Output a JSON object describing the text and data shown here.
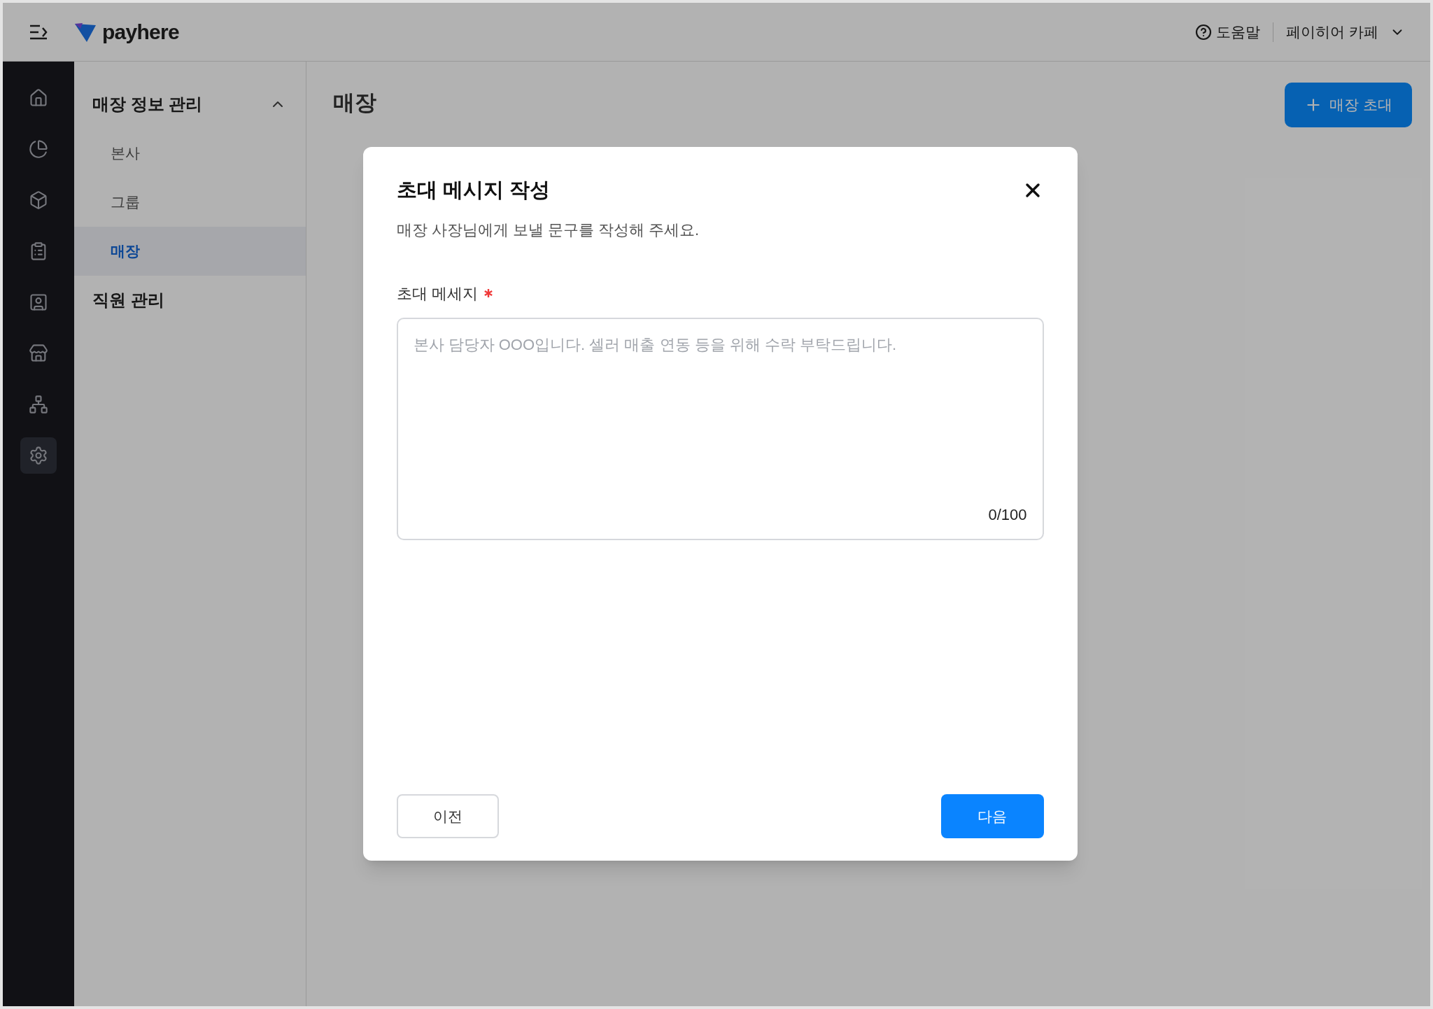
{
  "top_bar": {
    "logo_text": "payhere",
    "help": "도움말",
    "store": "페이히어 카페"
  },
  "rail": [
    {
      "kind": "home",
      "selected": false
    },
    {
      "kind": "chart",
      "selected": false
    },
    {
      "kind": "box",
      "selected": false
    },
    {
      "kind": "clipboard",
      "selected": false
    },
    {
      "kind": "contact",
      "selected": false
    },
    {
      "kind": "store",
      "selected": false
    },
    {
      "kind": "network",
      "selected": false
    },
    {
      "kind": "settings",
      "selected": true
    }
  ],
  "submenu": [
    {
      "label": "매장 정보 관리",
      "expanded": true,
      "children": [
        {
          "label": "본사",
          "selected": false
        },
        {
          "label": "그룹",
          "selected": false
        },
        {
          "label": "매장",
          "selected": true
        }
      ]
    },
    {
      "label": "직원 관리"
    }
  ],
  "page": {
    "title": "매장",
    "invite_button": "매장 초대"
  },
  "modal": {
    "title": "초대 메시지 작성",
    "subtitle": "매장 사장님에게 보낼 문구를 작성해 주세요.",
    "field": {
      "label": "초대 메세지",
      "required": true,
      "placeholder": "본사 담당자 OOO입니다. 셀러 매출 연동 등을 위해 수락 부탁드립니다.",
      "counter": "0/100"
    },
    "back_button": "이전",
    "next_button": "다음"
  }
}
